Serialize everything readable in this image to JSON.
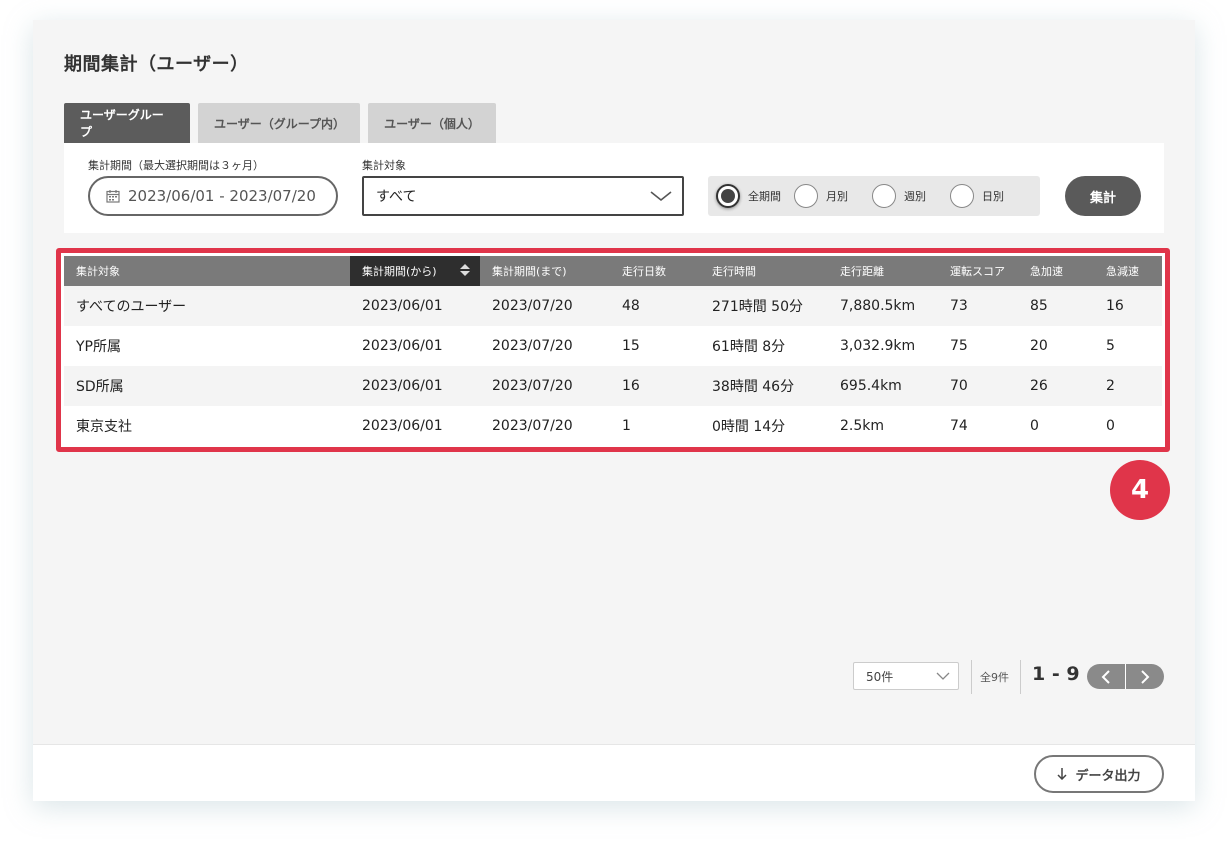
{
  "page": {
    "title": "期間集計（ユーザー）"
  },
  "tabs": [
    {
      "label": "ユーザーグループ",
      "active": true
    },
    {
      "label": "ユーザー（グループ内）",
      "active": false
    },
    {
      "label": "ユーザー（個人）",
      "active": false
    }
  ],
  "filters": {
    "period_label": "集計期間（最大選択期間は３ヶ月）",
    "period_value": "2023/06/01 - 2023/07/20",
    "target_label": "集計対象",
    "target_value": "すべて",
    "radio_options": [
      {
        "label": "全期間",
        "checked": true
      },
      {
        "label": "月別",
        "checked": false
      },
      {
        "label": "週別",
        "checked": false
      },
      {
        "label": "日別",
        "checked": false
      }
    ],
    "run_label": "集計"
  },
  "table": {
    "columns": [
      "集計対象",
      "集計期間(から)",
      "集計期間(まで)",
      "走行日数",
      "走行時間",
      "走行距離",
      "運転スコア",
      "急加速",
      "急減速"
    ],
    "sorted_column": 1,
    "rows": [
      [
        "すべてのユーザー",
        "2023/06/01",
        "2023/07/20",
        "48",
        "271時間 50分",
        "7,880.5km",
        "73",
        "85",
        "16"
      ],
      [
        "YP所属",
        "2023/06/01",
        "2023/07/20",
        "15",
        "61時間 8分",
        "3,032.9km",
        "75",
        "20",
        "5"
      ],
      [
        "SD所属",
        "2023/06/01",
        "2023/07/20",
        "16",
        "38時間 46分",
        "695.4km",
        "70",
        "26",
        "2"
      ],
      [
        "東京支社",
        "2023/06/01",
        "2023/07/20",
        "1",
        "0時間 14分",
        "2.5km",
        "74",
        "0",
        "0"
      ]
    ]
  },
  "annotation": {
    "badge": "4"
  },
  "pagination": {
    "page_size": "50件",
    "total": "全9件",
    "range": "1 - 9"
  },
  "footer": {
    "export_label": "データ出力"
  },
  "colors": {
    "accent_red": "#e0354a",
    "dark_button": "#5a5a5a",
    "header_gray": "#7a7a7a",
    "header_sorted": "#2e2e2e"
  }
}
